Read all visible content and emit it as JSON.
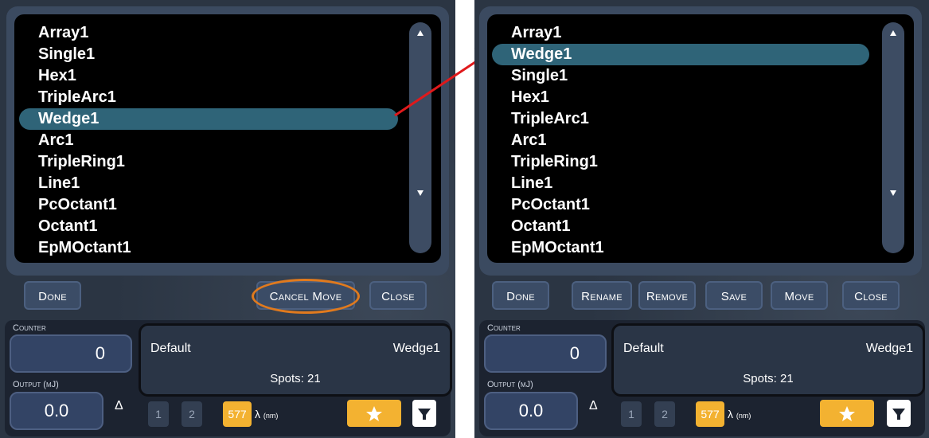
{
  "left": {
    "list": [
      "Array1",
      "Single1",
      "Hex1",
      "TripleArc1",
      "Wedge1",
      "Arc1",
      "TripleRing1",
      "Line1",
      "PcOctant1",
      "Octant1",
      "EpMOctant1"
    ],
    "buttons": {
      "done": "Done",
      "cancel_move": "Cancel Move",
      "close": "Close"
    },
    "counter_label": "Counter",
    "counter_value": "0",
    "output_label": "Output (mJ)",
    "output_value": "0.0",
    "delta": "Δ",
    "info_default": "Default",
    "info_name": "Wedge1",
    "info_spots": "Spots: 21",
    "wavelength_buttons": [
      "1",
      "2",
      "577"
    ],
    "lambda_label": "λ",
    "lambda_unit": "(nm)"
  },
  "right": {
    "list": [
      "Array1",
      "Wedge1",
      "Single1",
      "Hex1",
      "TripleArc1",
      "Arc1",
      "TripleRing1",
      "Line1",
      "PcOctant1",
      "Octant1",
      "EpMOctant1"
    ],
    "buttons": {
      "done": "Done",
      "rename": "Rename",
      "remove": "Remove",
      "save": "Save",
      "move": "Move",
      "close": "Close"
    },
    "counter_label": "Counter",
    "counter_value": "0",
    "output_label": "Output (mJ)",
    "output_value": "0.0",
    "delta": "Δ",
    "info_default": "Default",
    "info_name": "Wedge1",
    "info_spots": "Spots: 21",
    "wavelength_buttons": [
      "1",
      "2",
      "577"
    ],
    "lambda_label": "λ",
    "lambda_unit": "(nm)"
  },
  "colors": {
    "selection": "#2f6478",
    "accent": "#f3b231",
    "annotation_arrow": "#e0191b",
    "annotation_oval": "#e07a1e"
  },
  "icons": {
    "star": "star-icon",
    "filter": "filter-icon",
    "scroll_up": "chevron-up-icon",
    "scroll_down": "chevron-down-icon"
  }
}
